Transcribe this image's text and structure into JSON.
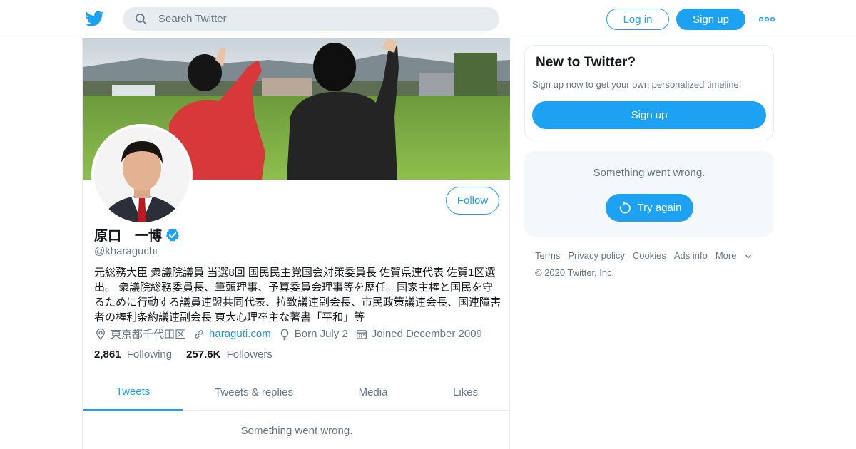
{
  "header": {
    "search_placeholder": "Search Twitter",
    "login_label": "Log in",
    "signup_label": "Sign up",
    "brand_color": "#1da1f2"
  },
  "profile": {
    "name": "原口　一博",
    "handle": "@kharaguchi",
    "bio": "元総務大臣 衆議院議員 当選8回 国民民主党国会対策委員長 佐賀県連代表 佐賀1区選出。 衆議院総務委員長、筆頭理事、予算委員会理事等を歴任。国家主権と国民を守るために行動する議員連盟共同代表、拉致議連副会長、市民政策議連会長、国連障害者の権利条約議連副会長 東大心理卒主な著書「平和」等",
    "location": "東京都千代田区",
    "website": "haraguti.com",
    "birthday": "Born July 2",
    "joined": "Joined December 2009",
    "following_count": "2,861",
    "following_label": "Following",
    "followers_count": "257.6K",
    "followers_label": "Followers",
    "follow_label": "Follow",
    "verified_icon": "verified-badge-icon"
  },
  "tabs": [
    {
      "label": "Tweets",
      "active": true
    },
    {
      "label": "Tweets & replies",
      "active": false
    },
    {
      "label": "Media",
      "active": false
    },
    {
      "label": "Likes",
      "active": false
    }
  ],
  "timeline": {
    "error_text": "Something went wrong."
  },
  "sidebar": {
    "new_title": "New to Twitter?",
    "new_subtitle": "Sign up now to get your own personalized timeline!",
    "signup_label": "Sign up",
    "error_text": "Something went wrong.",
    "try_again_label": "Try again"
  },
  "footer": {
    "links": [
      "Terms",
      "Privacy policy",
      "Cookies",
      "Ads info"
    ],
    "more_label": "More",
    "copyright": "© 2020 Twitter, Inc."
  }
}
